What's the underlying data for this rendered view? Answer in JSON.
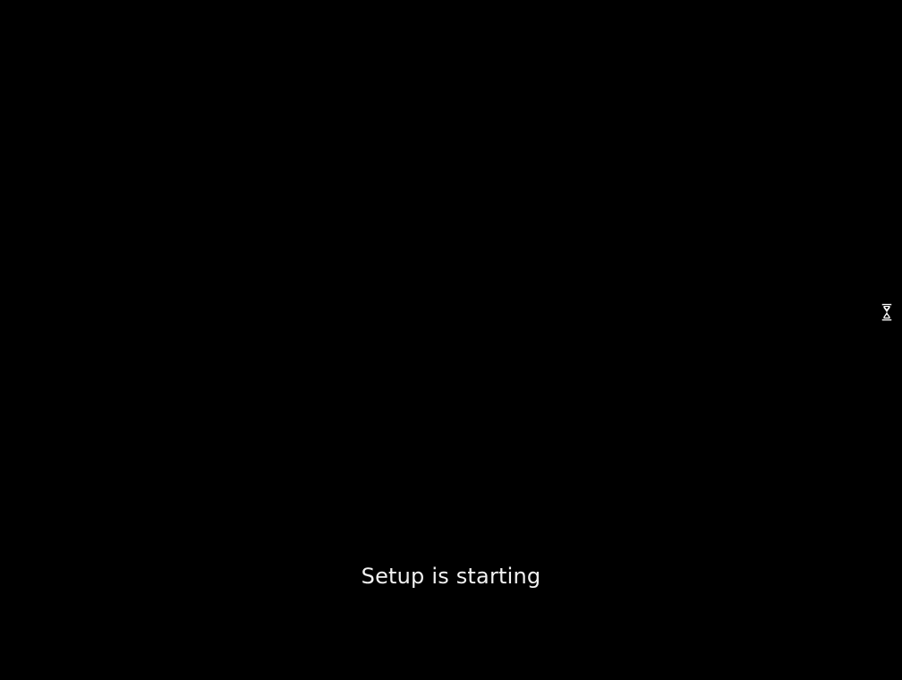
{
  "screen": {
    "status_text": "Setup is starting",
    "cursor_icon": "hourglass-icon",
    "background_color": "#000000",
    "text_color": "#f2f2f2"
  }
}
